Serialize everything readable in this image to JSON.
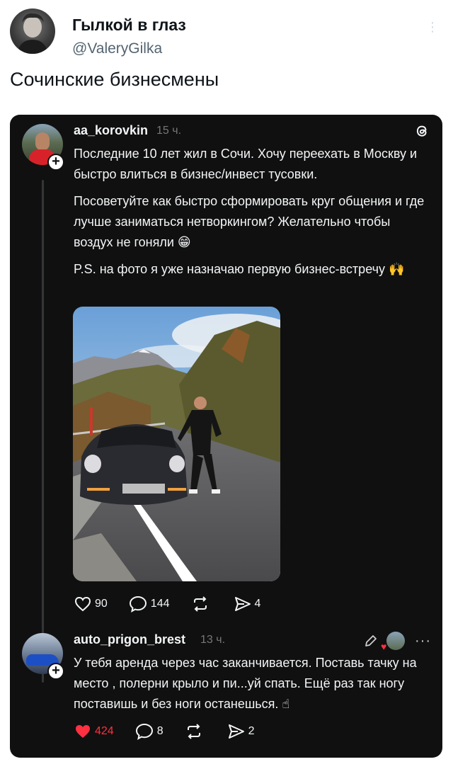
{
  "tweet": {
    "author_name": "Гылкой в глаз",
    "author_handle": "@ValeryGilka",
    "text": "Сочинские бизнесмены",
    "more_icon": "vertical-dots-icon"
  },
  "threads_post": {
    "username": "aa_korovkin",
    "time": "15 ч.",
    "paragraph_1": "Последние 10 лет жил в Сочи. Хочу переехать в Москву и быстро влиться в бизнес/инвест тусовки.",
    "paragraph_2": "Посоветуйте как быстро сформировать круг общения и где лучше заниматься нетворкингом? Желательно чтобы воздух не гоняли 😁",
    "paragraph_3": "P.S. на фото я уже назначаю первую бизнес-встречу 🙌",
    "stats": {
      "likes": "90",
      "comments": "144",
      "shares": "4"
    }
  },
  "threads_reply": {
    "username": "auto_prigon_brest",
    "time": "13 ч.",
    "text": "У тебя аренда через час заканчивается. Поставь тачку на место , полерни крыло и пи...уй спать. Ещё раз так ногу поставишь и без ноги останешься. ☝",
    "stats": {
      "likes": "424",
      "comments": "8",
      "shares": "2"
    }
  },
  "colors": {
    "like_active": "#ff3040",
    "dark_bg": "#101010",
    "muted": "#777777"
  }
}
